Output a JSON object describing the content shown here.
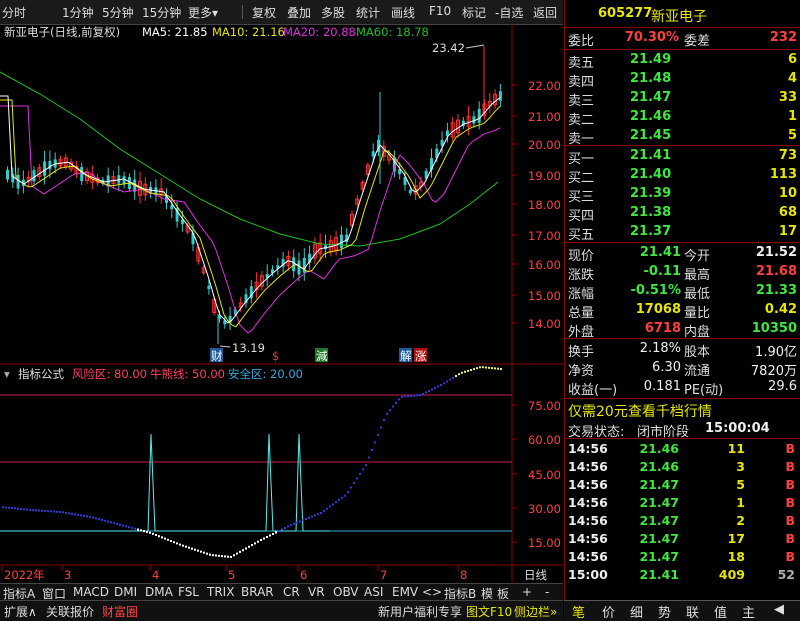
{
  "toolbar": {
    "items": [
      "分时",
      "1分钟",
      "5分钟",
      "15分钟",
      "更多▾",
      "复权",
      "叠加",
      "多股",
      "统计",
      "画线",
      "F10",
      "标记",
      "-自选",
      "返回"
    ]
  },
  "chart_header": {
    "stock": "新亚电子(日线,前复权)",
    "ma5": "MA5: 21.85",
    "ma10": "MA10: 21.16",
    "ma20": "MA20: 20.88",
    "ma60": "MA60: 18.78"
  },
  "price_axis": [
    "22.00",
    "21.00",
    "20.00",
    "19.00",
    "18.00",
    "17.00",
    "16.00",
    "15.00",
    "14.00"
  ],
  "annotations": {
    "high": "23.42",
    "low": "13.19"
  },
  "event_markers": [
    "财",
    "$",
    "減",
    "解",
    "涨"
  ],
  "indicator_header": {
    "title": "指标公式",
    "risk": "风险区: 80.00",
    "cow": "牛熊线: 50.00",
    "safe": "安全区: 20.00"
  },
  "indicator_axis": [
    "75.00",
    "60.00",
    "45.00",
    "30.00",
    "15.00"
  ],
  "date_axis": [
    "2022年",
    "3",
    "4",
    "5",
    "6",
    "7",
    "8"
  ],
  "period": "日线",
  "tabs": [
    "指标A",
    "窗口",
    "MACD",
    "DMI",
    "DMA",
    "FSL",
    "TRIX",
    "BRAR",
    "CR",
    "VR",
    "OBV",
    "ASI",
    "EMV",
    "<",
    ">",
    "指标B",
    "模",
    "板",
    "+",
    "-"
  ],
  "bottom": {
    "left": [
      "扩展∧",
      "关联报价",
      "财富圈"
    ],
    "right": [
      "新用户福利专享",
      "图文F10",
      "侧边栏»"
    ]
  },
  "quote": {
    "code": "605277",
    "name": "新亚电子",
    "weibi_label": "委比",
    "weibi": "70.30%",
    "weicha_label": "委差",
    "weicha": "232",
    "sell": [
      {
        "label": "卖五",
        "price": "21.49",
        "vol": "6"
      },
      {
        "label": "卖四",
        "price": "21.48",
        "vol": "4"
      },
      {
        "label": "卖三",
        "price": "21.47",
        "vol": "33"
      },
      {
        "label": "卖二",
        "price": "21.46",
        "vol": "1"
      },
      {
        "label": "卖一",
        "price": "21.45",
        "vol": "5"
      }
    ],
    "buy": [
      {
        "label": "买一",
        "price": "21.41",
        "vol": "73"
      },
      {
        "label": "买二",
        "price": "21.40",
        "vol": "113"
      },
      {
        "label": "买三",
        "price": "21.39",
        "vol": "10"
      },
      {
        "label": "买四",
        "price": "21.38",
        "vol": "68"
      },
      {
        "label": "买五",
        "price": "21.37",
        "vol": "17"
      }
    ],
    "stats": [
      {
        "l1": "现价",
        "v1": "21.41",
        "c1": "grn",
        "l2": "今开",
        "v2": "21.52",
        "c2": "wht"
      },
      {
        "l1": "涨跌",
        "v1": "-0.11",
        "c1": "grn",
        "l2": "最高",
        "v2": "21.68",
        "c2": "red"
      },
      {
        "l1": "涨幅",
        "v1": "-0.51%",
        "c1": "grn",
        "l2": "最低",
        "v2": "21.33",
        "c2": "grn"
      },
      {
        "l1": "总量",
        "v1": "17068",
        "c1": "yel",
        "l2": "量比",
        "v2": "0.42",
        "c2": "yel"
      },
      {
        "l1": "外盘",
        "v1": "6718",
        "c1": "red",
        "l2": "内盘",
        "v2": "10350",
        "c2": "grn"
      }
    ],
    "stats2": [
      {
        "l1": "换手",
        "v1": "2.18%",
        "l2": "股本",
        "v2": "1.90亿"
      },
      {
        "l1": "净资",
        "v1": "6.30",
        "l2": "流通",
        "v2": "7820万"
      },
      {
        "l1": "收益(一)",
        "v1": "0.181",
        "l2": "PE(动)",
        "v2": "29.6"
      }
    ],
    "promo": "仅需20元查看千档行情",
    "status_label": "交易状态:",
    "status": "闭市阶段",
    "time": "15:00:04",
    "ticks": [
      {
        "t": "14:56",
        "p": "21.46",
        "v": "11",
        "s": "B"
      },
      {
        "t": "14:56",
        "p": "21.46",
        "v": "3",
        "s": "B"
      },
      {
        "t": "14:56",
        "p": "21.47",
        "v": "5",
        "s": "B"
      },
      {
        "t": "14:56",
        "p": "21.47",
        "v": "1",
        "s": "B"
      },
      {
        "t": "14:56",
        "p": "21.47",
        "v": "2",
        "s": "B"
      },
      {
        "t": "14:56",
        "p": "21.47",
        "v": "17",
        "s": "B"
      },
      {
        "t": "14:56",
        "p": "21.47",
        "v": "18",
        "s": "B"
      },
      {
        "t": "15:00",
        "p": "21.41",
        "v": "409",
        "s": "52"
      }
    ],
    "bottom_tabs": [
      "笔",
      "价",
      "细",
      "势",
      "联",
      "值",
      "主",
      "◀"
    ]
  }
}
